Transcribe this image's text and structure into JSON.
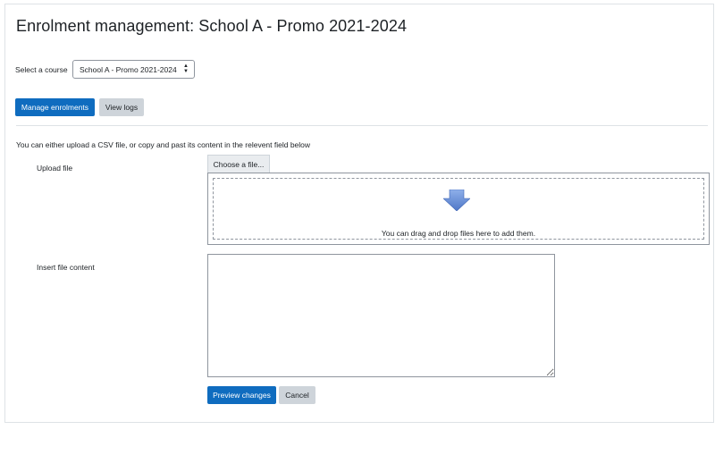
{
  "page": {
    "title": "Enrolment management: School A - Promo 2021-2024"
  },
  "course_selector": {
    "label": "Select a course",
    "selected": "School A - Promo 2021-2024"
  },
  "actions": {
    "manage_enrolments": "Manage enrolments",
    "view_logs": "View logs"
  },
  "instructions": "You can either upload a CSV file, or copy and past its content in the relevent field below",
  "upload": {
    "label": "Upload file",
    "choose_button": "Choose a file...",
    "dropzone_text": "You can drag and drop files here to add them."
  },
  "file_content": {
    "label": "Insert file content",
    "value": ""
  },
  "form_buttons": {
    "preview": "Preview changes",
    "cancel": "Cancel"
  },
  "colors": {
    "primary": "#0f6cbf",
    "secondary": "#ced4da",
    "arrow": "#6b8dd6"
  }
}
